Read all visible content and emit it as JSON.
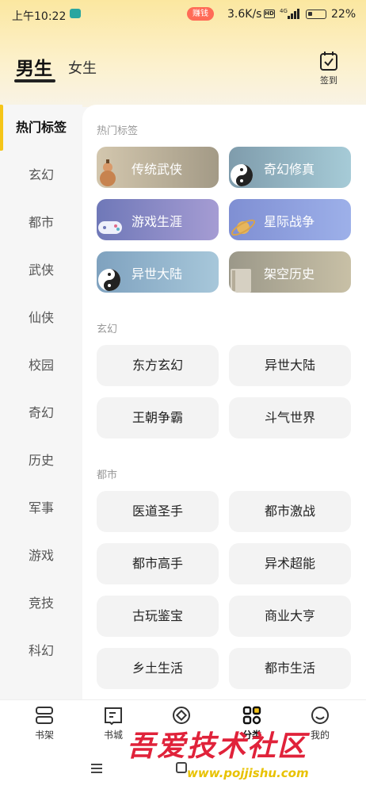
{
  "status_bar": {
    "time": "上午10:22",
    "speed": "3.6K/s",
    "hd": "HD",
    "network": "4G",
    "battery": "22%"
  },
  "header": {
    "tabs": [
      {
        "label": "男生",
        "active": true
      },
      {
        "label": "女生",
        "active": false
      }
    ],
    "checkin_label": "签到"
  },
  "sidebar": {
    "items": [
      "热门标签",
      "玄幻",
      "都市",
      "武侠",
      "仙侠",
      "校园",
      "奇幻",
      "历史",
      "军事",
      "游戏",
      "竞技",
      "科幻"
    ],
    "active_index": 0
  },
  "sections": {
    "hot": {
      "title": "热门标签",
      "tags": [
        {
          "label": "传统武侠",
          "icon": "gourd-icon",
          "color_from": "#d3c7ae",
          "color_to": "#a39a86"
        },
        {
          "label": "奇幻修真",
          "icon": "yin-yang-icon",
          "color_from": "#7f9cac",
          "color_to": "#a6cbd7"
        },
        {
          "label": "游戏生涯",
          "icon": "gamepad-icon",
          "color_from": "#6f78b8",
          "color_to": "#a59cd3"
        },
        {
          "label": "星际战争",
          "icon": "planet-icon",
          "color_from": "#7f8fd3",
          "color_to": "#9db0e9"
        },
        {
          "label": "异世大陆",
          "icon": "yin-yang-icon",
          "color_from": "#7fa2bf",
          "color_to": "#a7c7da"
        },
        {
          "label": "架空历史",
          "icon": "book-icon",
          "color_from": "#9b9889",
          "color_to": "#c8c0a6"
        }
      ]
    },
    "xuanhuan": {
      "title": "玄幻",
      "tags": [
        "东方玄幻",
        "异世大陆",
        "王朝争霸",
        "斗气世界"
      ]
    },
    "dushi": {
      "title": "都市",
      "tags": [
        "医道圣手",
        "都市激战",
        "都市高手",
        "异术超能",
        "古玩鉴宝",
        "商业大亨",
        "乡土生活",
        "都市生活"
      ]
    }
  },
  "bottom_nav": {
    "items": [
      {
        "label": "书架",
        "icon": "bookshelf-icon"
      },
      {
        "label": "书城",
        "icon": "book-open-icon"
      },
      {
        "label": "",
        "icon": "earn-icon"
      },
      {
        "label": "分类",
        "icon": "category-icon"
      },
      {
        "label": "我的",
        "icon": "profile-icon"
      }
    ],
    "badge": "赚钱"
  },
  "watermark": {
    "text": "吾爱技术社区",
    "url": "www.pojjishu.com"
  },
  "colors": {
    "accent": "#f5c518",
    "badge": "#ff6b57"
  }
}
